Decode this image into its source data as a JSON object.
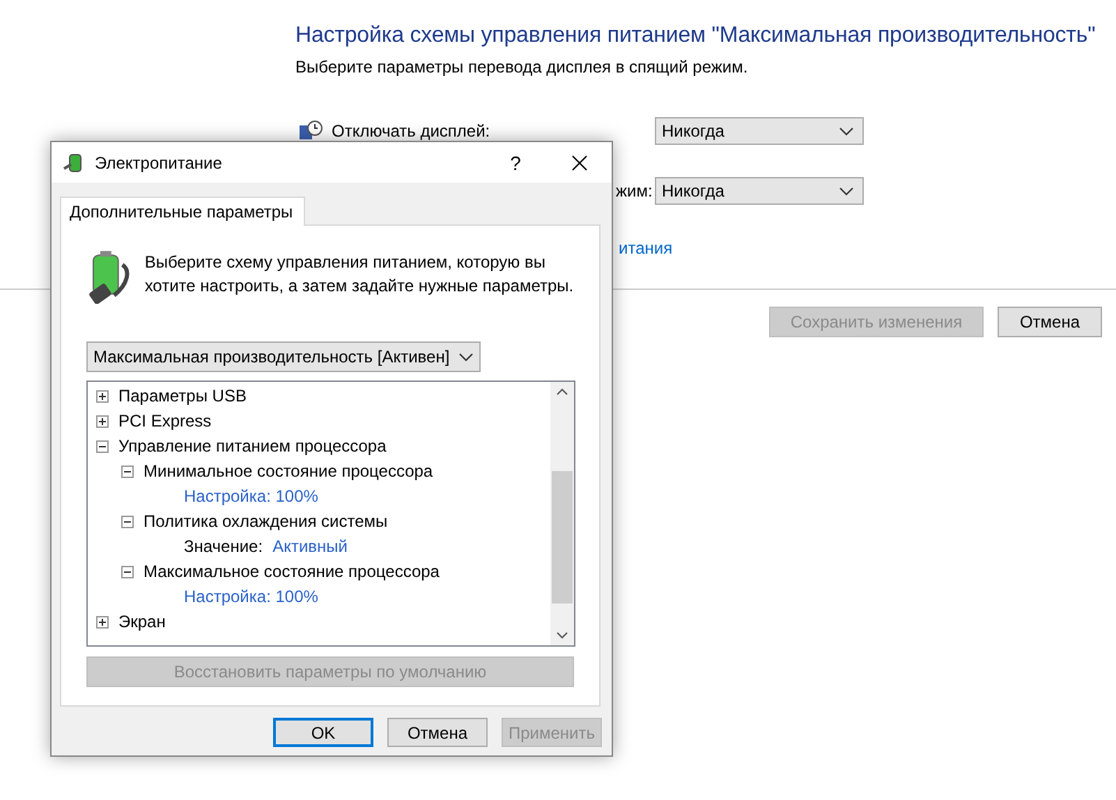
{
  "background": {
    "title": "Настройка схемы управления питанием \"Максимальная производительность\"",
    "subtitle": "Выберите параметры перевода дисплея в спящий режим.",
    "settings": [
      {
        "label": "Отключать дисплей:",
        "value": "Никогда"
      },
      {
        "label": "жим:",
        "value": "Никогда"
      }
    ],
    "link": "итания",
    "buttons": [
      {
        "label": "Сохранить изменения",
        "disabled": true
      },
      {
        "label": "Отмена",
        "disabled": false
      }
    ]
  },
  "dialog": {
    "title": "Электропитание",
    "help": "?",
    "tabs": [
      {
        "label": "Дополнительные параметры",
        "selected": true
      }
    ],
    "description": "Выберите схему управления питанием, которую вы хотите настроить, а затем задайте нужные параметры.",
    "plan": "Максимальная производительность [Активен]",
    "tree": [
      {
        "kind": "node",
        "label": "Параметры USB",
        "expanded": false
      },
      {
        "kind": "node",
        "label": "PCI Express",
        "expanded": false
      },
      {
        "kind": "node",
        "label": "Управление питанием процессора",
        "expanded": true,
        "children": [
          {
            "kind": "node",
            "label": "Минимальное состояние процессора",
            "expanded": true,
            "children": [
              {
                "kind": "setting",
                "label": "Настройка: 100%"
              }
            ]
          },
          {
            "kind": "node",
            "label": "Политика охлаждения системы",
            "expanded": true,
            "children": [
              {
                "kind": "value",
                "label": "Значение:",
                "value": "Активный"
              }
            ]
          },
          {
            "kind": "node",
            "label": "Максимальное состояние процессора",
            "expanded": true,
            "children": [
              {
                "kind": "setting",
                "label": "Настройка: 100%"
              }
            ]
          }
        ]
      },
      {
        "kind": "node",
        "label": "Экран",
        "expanded": false
      }
    ],
    "restore": {
      "label": "Восстановить параметры по умолчанию",
      "disabled": true
    },
    "buttons": [
      {
        "label": "OK",
        "disabled": false,
        "default": true
      },
      {
        "label": "Отмена",
        "disabled": false,
        "default": false
      },
      {
        "label": "Применить",
        "disabled": true,
        "default": false
      }
    ]
  }
}
